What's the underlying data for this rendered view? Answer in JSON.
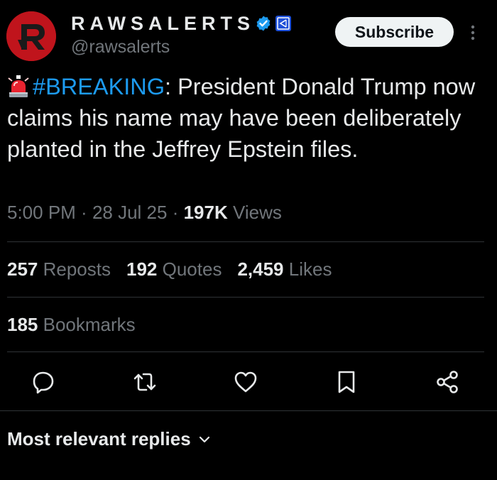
{
  "author": {
    "display_name": "RAWSALERTS",
    "handle": "@rawsalerts",
    "subscribe_label": "Subscribe",
    "avatar_color": "#c0141c",
    "verified_color": "#1d9bf0"
  },
  "tweet": {
    "emoji_icon": "police-car-light-icon",
    "hashtag": "#BREAKING",
    "text": ": President Donald Trump now claims his name may have been deliberately planted in the Jeffrey Epstein files.",
    "time": "5:00 PM",
    "sep1": " · ",
    "date": "28 Jul 25",
    "sep2": " · ",
    "views_count": "197K",
    "views_label": " Views"
  },
  "stats": {
    "reposts_count": "257",
    "reposts_label": " Reposts",
    "quotes_count": "192",
    "quotes_label": " Quotes",
    "likes_count": "2,459",
    "likes_label": " Likes",
    "bookmarks_count": "185",
    "bookmarks_label": " Bookmarks"
  },
  "actions": [
    "reply-icon",
    "repost-icon",
    "like-icon",
    "bookmark-icon",
    "share-icon"
  ],
  "replies": {
    "sort_label": "Most relevant replies"
  },
  "colors": {
    "background": "#000000",
    "text": "#e7e9ea",
    "secondary": "#71767b",
    "accent": "#1d9bf0",
    "divider": "#2f3336"
  }
}
